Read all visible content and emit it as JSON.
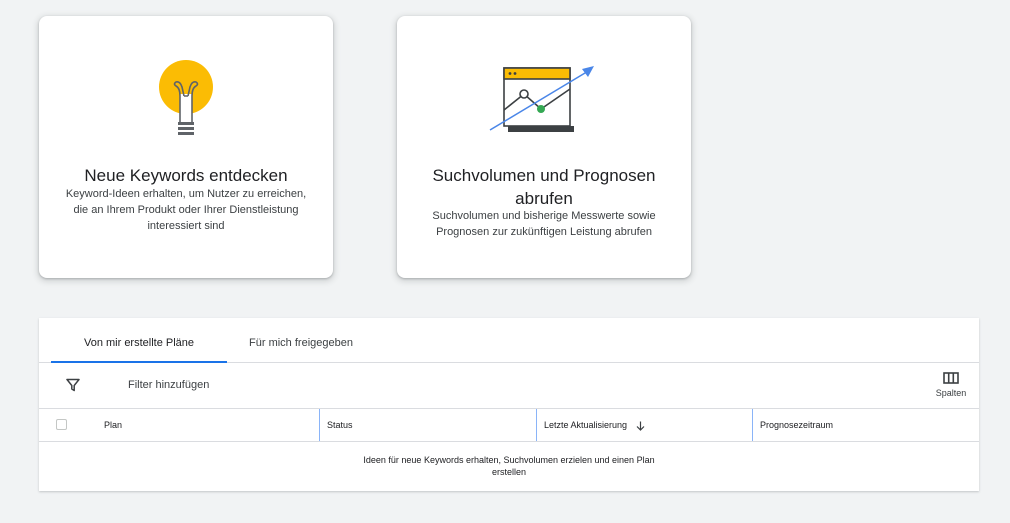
{
  "cards": [
    {
      "title": "Neue Keywords entdecken",
      "description": "Keyword-Ideen erhalten, um Nutzer zu erreichen, die an Ihrem Produkt oder Ihrer Dienstleistung interessiert sind",
      "icon": "lightbulb-icon"
    },
    {
      "title": "Suchvolumen und Prognosen abrufen",
      "description": "Suchvolumen und bisherige Messwerte sowie Prognosen zur zukünftigen Leistung abrufen",
      "icon": "trend-chart-icon"
    }
  ],
  "tabs": [
    {
      "label": "Von mir erstellte Pläne",
      "active": true
    },
    {
      "label": "Für mich freigegeben",
      "active": false
    }
  ],
  "filter": {
    "label": "Filter hinzufügen",
    "icon": "filter-icon"
  },
  "columns_button": {
    "label": "Spalten",
    "icon": "columns-icon"
  },
  "table": {
    "headers": {
      "plan": "Plan",
      "status": "Status",
      "updated": "Letzte Aktualisierung",
      "forecast": "Prognosezeitraum"
    },
    "sort": {
      "column": "updated",
      "direction": "descending"
    },
    "empty_message": "Ideen für neue Keywords erhalten, Suchvolumen erzielen und einen Plan erstellen"
  },
  "colors": {
    "accent": "#1a73e8",
    "bulb": "#fbbc04",
    "background": "#f1f3f4",
    "chart_point": "#34a853"
  }
}
